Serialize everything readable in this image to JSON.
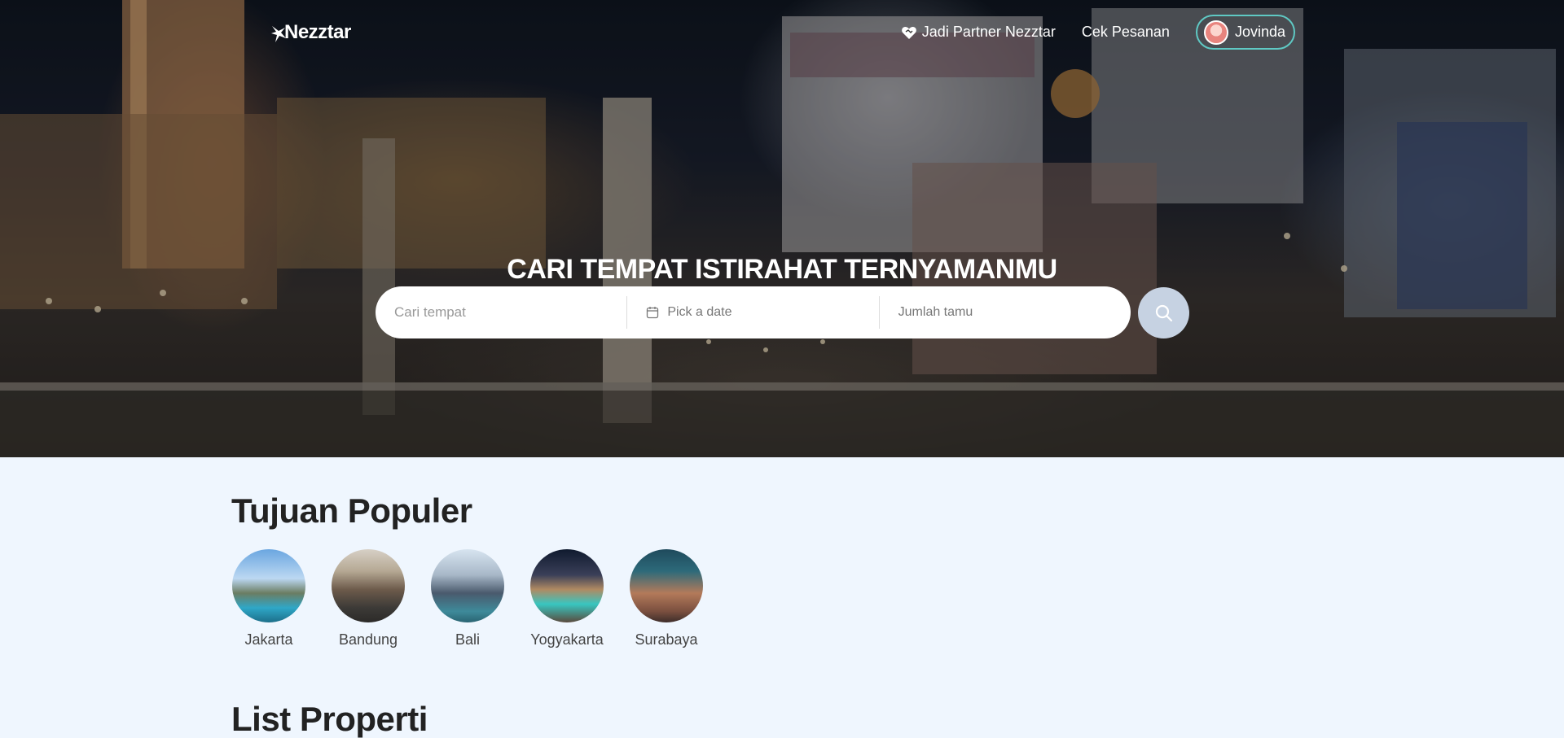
{
  "brand": {
    "name": "Nezztar",
    "icon": "star-bird-icon"
  },
  "nav": {
    "partner_label": "Jadi Partner Nezztar",
    "partner_icon": "heart-handshake-icon",
    "orders_label": "Cek Pesanan",
    "user_name": "Jovinda"
  },
  "hero": {
    "title": "CARI TEMPAT ISTIRAHAT TERNYAMANMU",
    "search": {
      "place_placeholder": "Cari tempat",
      "date_placeholder": "Pick a date",
      "guests_placeholder": "Jumlah tamu",
      "button_icon": "search-icon"
    }
  },
  "popular": {
    "title": "Tujuan Populer",
    "destinations": [
      {
        "name": "Jakarta"
      },
      {
        "name": "Bandung"
      },
      {
        "name": "Bali"
      },
      {
        "name": "Yogyakarta"
      },
      {
        "name": "Surabaya"
      }
    ]
  },
  "properties": {
    "title": "List Properti"
  },
  "colors": {
    "page_bg": "#eff6fe",
    "accent_border": "#5fc9c4",
    "search_button": "#c6d2e2"
  }
}
